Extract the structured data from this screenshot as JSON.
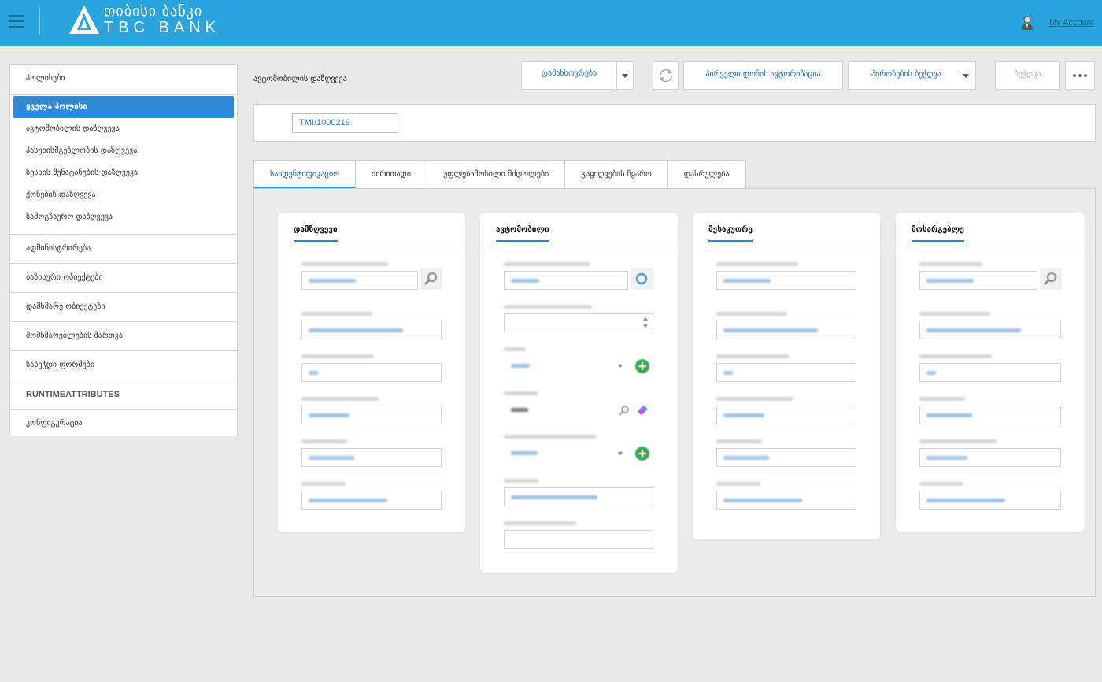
{
  "header": {
    "logo_line1": "თიბისი ბანკი",
    "logo_line2": "TBC BANK",
    "account_link": "My Account",
    "color": "#29a4dc"
  },
  "sidebar": {
    "sections": [
      {
        "label": "პოლისები"
      },
      {
        "label": "ადმინისტრირება"
      },
      {
        "label": "ბაზისური ობიექტები"
      },
      {
        "label": "დამხმარე ობიექტები"
      },
      {
        "label": "მომხმარებლების მართვა"
      },
      {
        "label": "საბეჭდი ფორმები"
      },
      {
        "label": "RUNTIMEATTRIBUTES"
      },
      {
        "label": "კონფიგურაცია"
      }
    ],
    "policy_items": [
      {
        "label": "ყველა პოლისი",
        "active": true
      },
      {
        "label": "ავტომობილის დაზღვევა"
      },
      {
        "label": "პასუხისმგებლობის დაზღვევა"
      },
      {
        "label": "სესხის შენატანების დაზღვევა"
      },
      {
        "label": "ქონების დაზღვევა"
      },
      {
        "label": "სამოგზაურო დაზღვევა"
      }
    ]
  },
  "main": {
    "page_title": "ავტომობილის დაზღვევა",
    "toolbar": {
      "save": "დამახსოვრება",
      "first_auth": "პირველი დონის ავტორიზაცია",
      "print_conditions": "პირობების ბეჭდვა",
      "print": "ბეჭდვა"
    },
    "policy_number": "TMI/1000219",
    "tabs": [
      {
        "label": "საიდენტიფიკაციო",
        "active": true
      },
      {
        "label": "ძირითადი"
      },
      {
        "label": "უფლებამოსილი მძღოლები"
      },
      {
        "label": "გაყიდვების წყარო"
      },
      {
        "label": "დასრულება"
      }
    ],
    "cards": [
      {
        "title": "დამზღვევი"
      },
      {
        "title": "ავტომობილი"
      },
      {
        "title": "მესაკუთრე"
      },
      {
        "title": "მოსარგებლე"
      }
    ]
  }
}
